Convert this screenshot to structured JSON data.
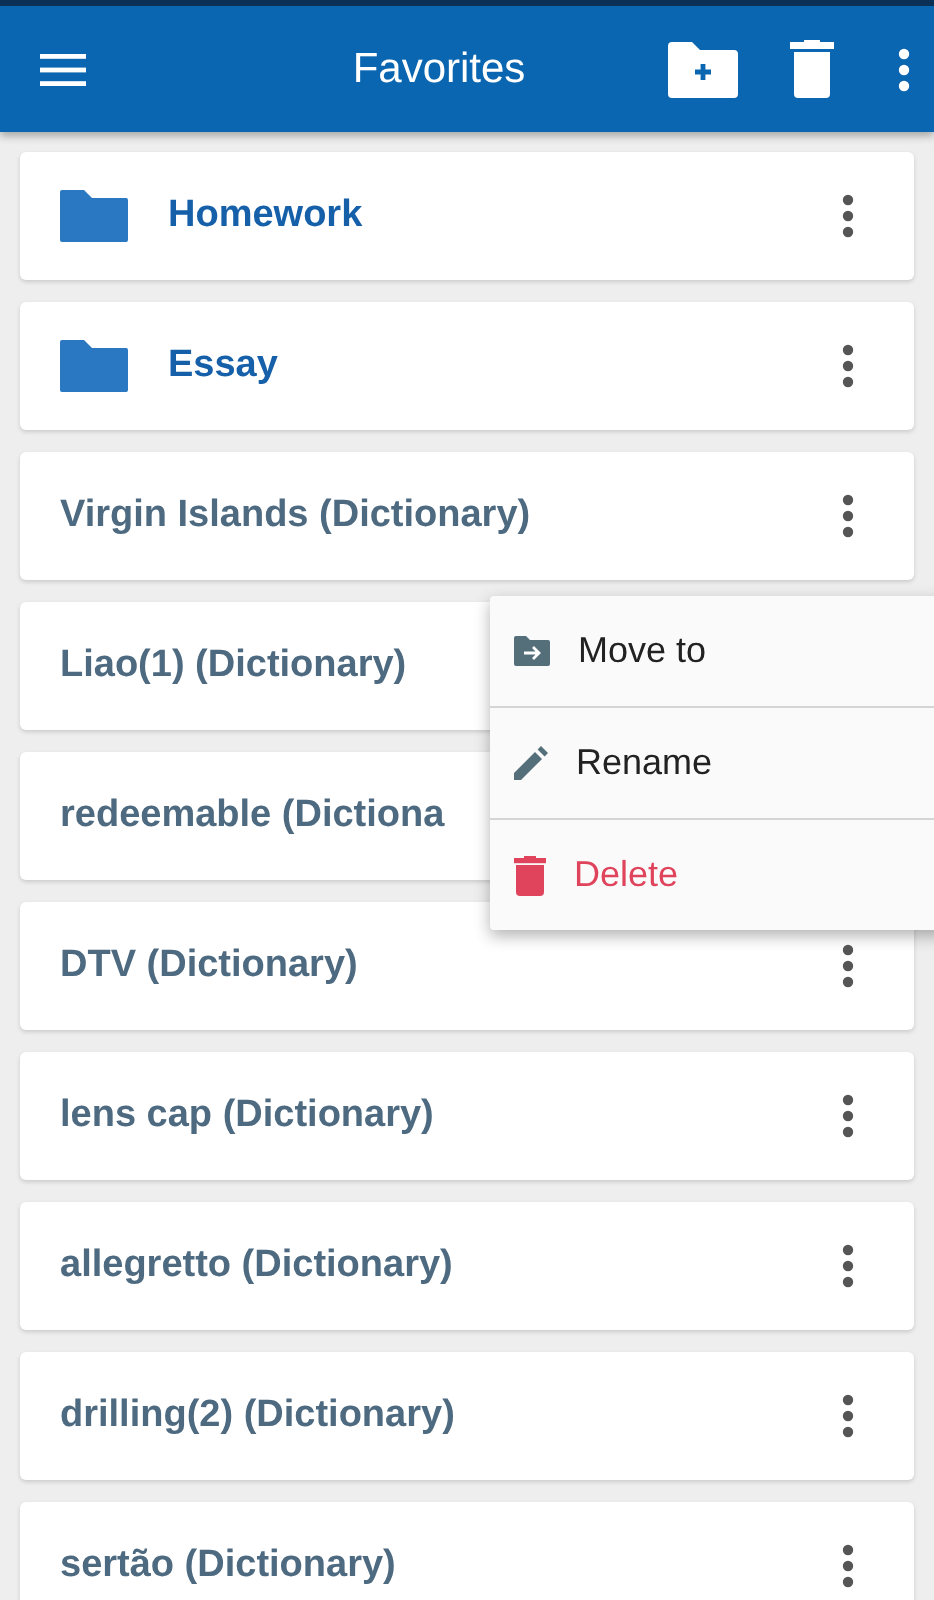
{
  "app_bar": {
    "title": "Favorites"
  },
  "items": [
    {
      "kind": "folder",
      "label": "Homework"
    },
    {
      "kind": "folder",
      "label": "Essay"
    },
    {
      "kind": "entry",
      "label": "Virgin Islands (Dictionary)"
    },
    {
      "kind": "entry",
      "label": "Liao(1) (Dictionary)"
    },
    {
      "kind": "entry",
      "label": "redeemable (Dictiona"
    },
    {
      "kind": "entry",
      "label": "DTV (Dictionary)"
    },
    {
      "kind": "entry",
      "label": "lens cap (Dictionary)"
    },
    {
      "kind": "entry",
      "label": "allegretto (Dictionary)"
    },
    {
      "kind": "entry",
      "label": "drilling(2) (Dictionary)"
    },
    {
      "kind": "entry",
      "label": "sertão (Dictionary)"
    }
  ],
  "context_menu": [
    {
      "kind": "move",
      "label": "Move to"
    },
    {
      "kind": "rename",
      "label": "Rename"
    },
    {
      "kind": "delete",
      "label": "Delete"
    }
  ]
}
